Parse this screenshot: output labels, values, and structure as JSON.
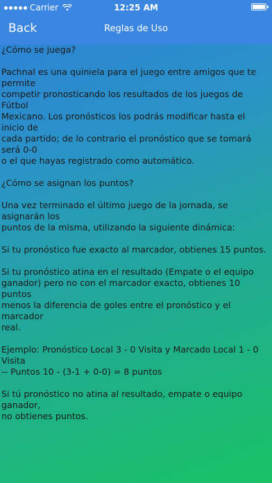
{
  "status_bar": {
    "carrier": "Carrier",
    "time": "12:25 AM",
    "battery_level": 1.0
  },
  "nav": {
    "back_label": "Back",
    "title": "Reglas de Uso"
  },
  "content": {
    "paragraphs": [
      "¿Cómo se juega?",
      "Pachnal es una quiniela para el juego entre amigos que te permite\ncompetir pronosticando los resultados de los juegos de Fútbol\nMexicano. Los pronósticos los podrás modificar hasta el inicio de\ncada partido; de lo contrario el pronóstico que se tomará será 0-0\no el que hayas registrado como automático.",
      "¿Cómo se asignan los puntos?",
      "Una vez terminado el último juego de la jornada, se asignarán los\npuntos de la misma, utilizando la siguiente dinámica:",
      "Si tu pronóstico fue exacto al marcador, obtienes 15 puntos.",
      "Si tu pronóstico atina en el resultado (Empate o el equipo\nganador) pero no con el marcador exacto, obtienes 10 puntos\nmenos la diferencia de goles entre el pronóstico y el marcador\nreal.",
      "Ejemplo: Pronóstico Local 3 - 0 Visita y Marcado Local 1 - 0 Visita\n-- Puntos 10 - (3-1 + 0-0) = 8 puntos",
      "Si tú pronóstico no atina al resultado, empate o equipo ganador,\nno obtienes puntos."
    ]
  }
}
